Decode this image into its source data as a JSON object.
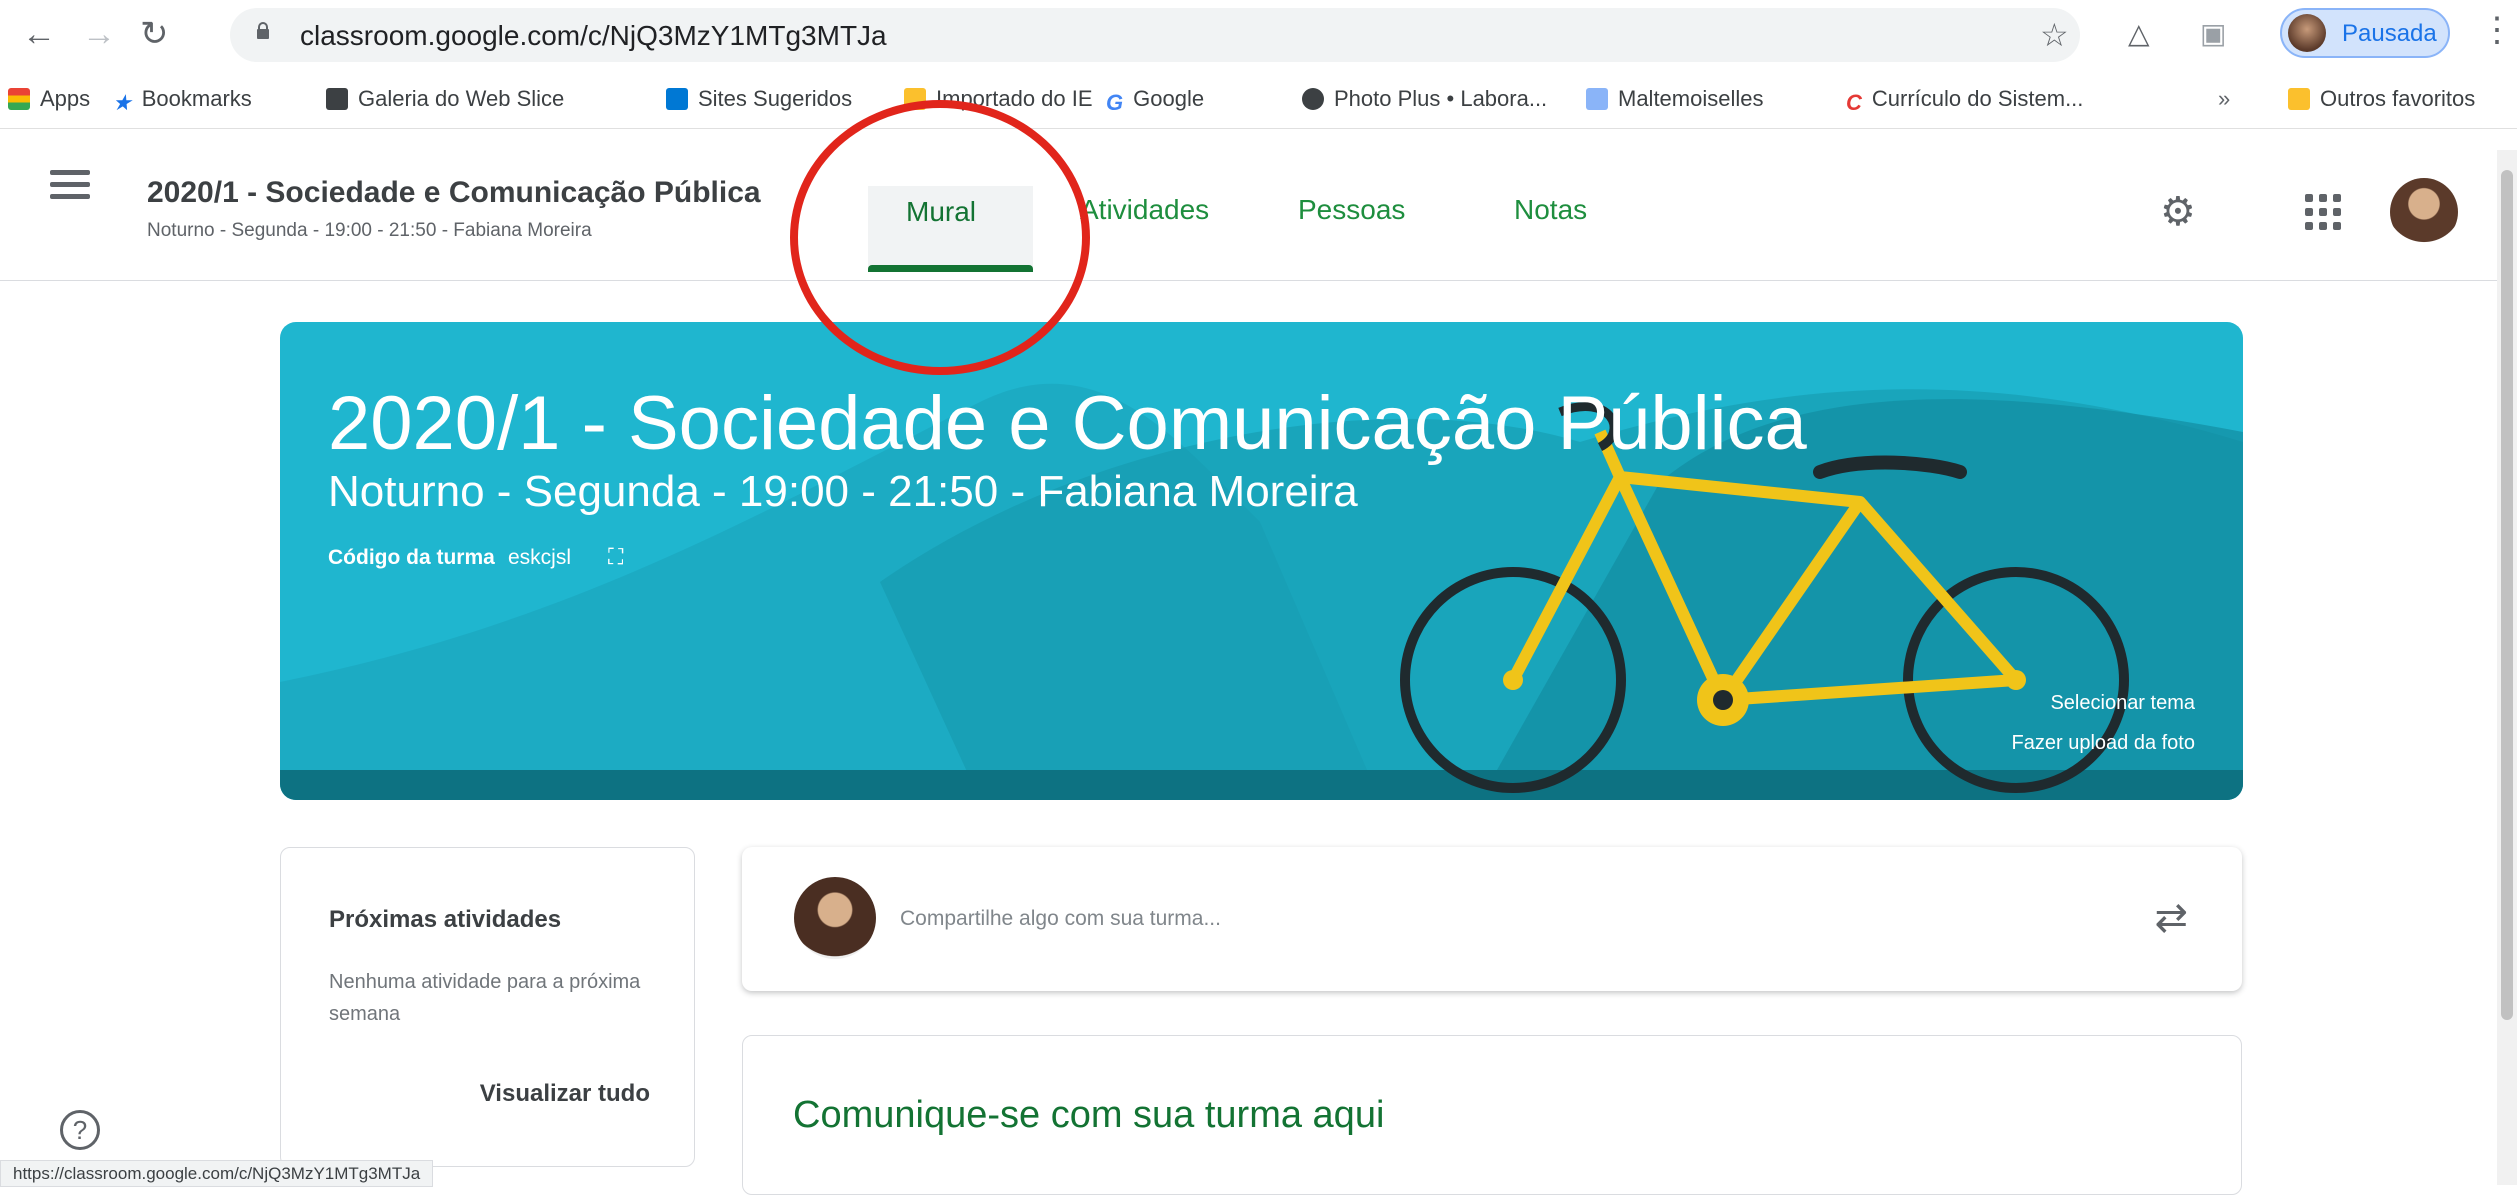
{
  "browser": {
    "url": "classroom.google.com/c/NjQ3MzY1MTg3MTJa",
    "profile_status": "Pausada",
    "bookmarks": [
      "Apps",
      "Bookmarks",
      "Galeria do Web Slice",
      "Sites Sugeridos",
      "Importado do IE",
      "Google",
      "Photo Plus • Labora...",
      "Maltemoiselles",
      "Currículo do Sistem...",
      "Outros favoritos"
    ],
    "status_url": "https://classroom.google.com/c/NjQ3MzY1MTg3MTJa"
  },
  "header": {
    "course_title": "2020/1 - Sociedade e Comunicação Pública",
    "course_subtitle": "Noturno - Segunda - 19:00 - 21:50 - Fabiana Moreira",
    "tabs": [
      "Mural",
      "Atividades",
      "Pessoas",
      "Notas"
    ]
  },
  "banner": {
    "title": "2020/1 - Sociedade e Comunicação Pública",
    "subtitle": "Noturno - Segunda - 19:00 - 21:50 - Fabiana Moreira",
    "code_label": "Código da turma",
    "code_value": "eskcjsl",
    "select_theme": "Selecionar tema",
    "upload_photo": "Fazer upload da foto"
  },
  "upcoming": {
    "title": "Próximas atividades",
    "empty_text": "Nenhuma atividade para a próxima semana",
    "view_all": "Visualizar tudo"
  },
  "stream": {
    "share_placeholder": "Compartilhe algo com sua turma...",
    "communicate_title": "Comunique-se com sua turma aqui"
  },
  "colors": {
    "accent_green": "#137333",
    "banner_teal": "#1fb6cf",
    "highlight_red": "#e1251b"
  }
}
